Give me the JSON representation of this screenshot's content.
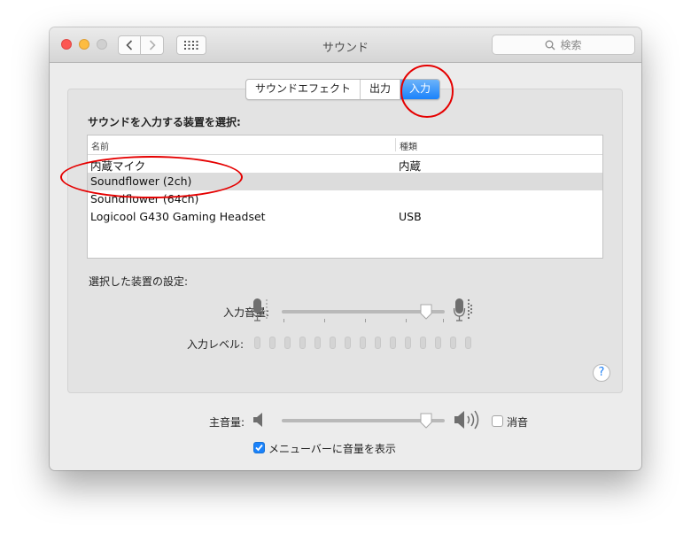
{
  "window": {
    "title": "サウンド",
    "search_placeholder": "検索"
  },
  "tabs": [
    {
      "label": "サウンドエフェクト",
      "active": false
    },
    {
      "label": "出力",
      "active": false
    },
    {
      "label": "入力",
      "active": true
    }
  ],
  "input": {
    "section_label": "サウンドを入力する装置を選択:",
    "columns": {
      "name": "名前",
      "type": "種類"
    },
    "devices": [
      {
        "name": "内蔵マイク",
        "type": "内蔵"
      },
      {
        "name": "Soundflower (2ch)",
        "type": ""
      },
      {
        "name": "Soundflower (64ch)",
        "type": ""
      },
      {
        "name": "Logicool G430 Gaming Headset",
        "type": "USB"
      }
    ],
    "selected_index": 1,
    "settings_label": "選択した装置の設定:",
    "input_volume_label": "入力音量:",
    "input_volume_value": 0.92,
    "input_level_label": "入力レベル:",
    "input_level_value": 0
  },
  "output": {
    "master_volume_label": "主音量:",
    "master_volume_value": 0.92,
    "mute_label": "消音",
    "mute_checked": false,
    "show_in_menubar_label": "メニューバーに音量を表示",
    "show_in_menubar_checked": true
  },
  "help_label": "?",
  "colors": {
    "accent": "#1a82fb",
    "annotation": "#e50000"
  }
}
